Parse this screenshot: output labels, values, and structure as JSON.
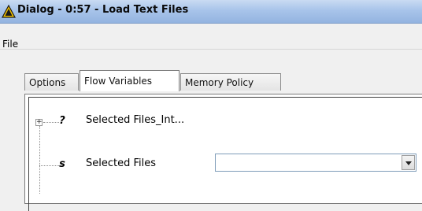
{
  "window": {
    "title": "Dialog - 0:57 - Load Text Files",
    "icon": "warning-triangle-icon"
  },
  "menu": {
    "file_label": "File"
  },
  "tabs": [
    {
      "label": "Options",
      "selected": false
    },
    {
      "label": "Flow Variables",
      "selected": true
    },
    {
      "label": "Memory Policy",
      "selected": false
    }
  ],
  "tree": {
    "rows": [
      {
        "type_glyph": "?",
        "label": "Selected Files_Int...",
        "expandable": true
      },
      {
        "type_glyph": "s",
        "label": "Selected Files",
        "combo_value": ""
      }
    ]
  },
  "colors": {
    "titlebar": "#a8c4ea",
    "warning_fill": "#f5c400"
  }
}
